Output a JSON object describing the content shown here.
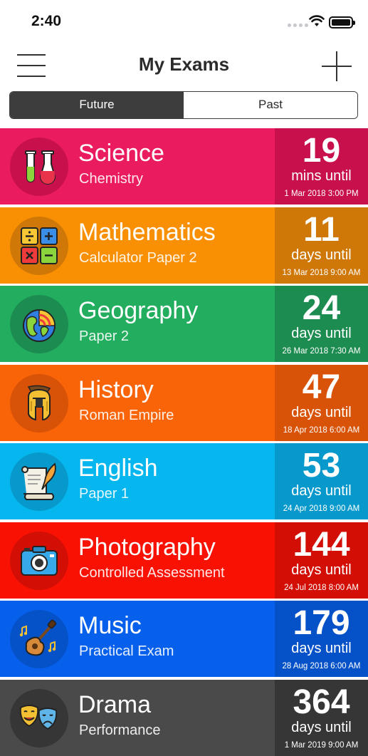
{
  "status_bar": {
    "time": "2:40"
  },
  "nav": {
    "title": "My Exams"
  },
  "segments": {
    "future": "Future",
    "past": "Past",
    "selected": "Future"
  },
  "exams": [
    {
      "subject": "Science",
      "topic": "Chemistry",
      "count": "19",
      "unit": "mins until",
      "date": "1 Mar 2018 3:00 PM",
      "color": "#ea1b5f",
      "accent": "#c8104c",
      "icon": "test-tubes-icon"
    },
    {
      "subject": "Mathematics",
      "topic": "Calculator Paper 2",
      "count": "11",
      "unit": "days until",
      "date": "13 Mar 2018 9:00 AM",
      "color": "#f99003",
      "accent": "#cf7707",
      "icon": "calculator-symbols-icon"
    },
    {
      "subject": "Geography",
      "topic": "Paper 2",
      "count": "24",
      "unit": "days until",
      "date": "26 Mar 2018 7:30 AM",
      "color": "#23ad5f",
      "accent": "#1d8c50",
      "icon": "globe-icon"
    },
    {
      "subject": "History",
      "topic": "Roman Empire",
      "count": "47",
      "unit": "days until",
      "date": "18 Apr 2018 6:00 AM",
      "color": "#f96408",
      "accent": "#d85207",
      "icon": "roman-helmet-icon"
    },
    {
      "subject": "English",
      "topic": "Paper 1",
      "count": "53",
      "unit": "days until",
      "date": "24 Apr 2018 9:00 AM",
      "color": "#05b7ee",
      "accent": "#0799cb",
      "icon": "scroll-quill-icon"
    },
    {
      "subject": "Photography",
      "topic": "Controlled Assessment",
      "count": "144",
      "unit": "days until",
      "date": "24 Jul 2018 8:00 AM",
      "color": "#f91104",
      "accent": "#d20e05",
      "icon": "camera-icon"
    },
    {
      "subject": "Music",
      "topic": "Practical Exam",
      "count": "179",
      "unit": "days until",
      "date": "28 Aug 2018 6:00 AM",
      "color": "#0760ec",
      "accent": "#0552c8",
      "icon": "guitar-icon"
    },
    {
      "subject": "Drama",
      "topic": "Performance",
      "count": "364",
      "unit": "days until",
      "date": "1 Mar 2019 9:00 AM",
      "color": "#4a4a4a",
      "accent": "#363636",
      "icon": "theatre-masks-icon"
    }
  ]
}
